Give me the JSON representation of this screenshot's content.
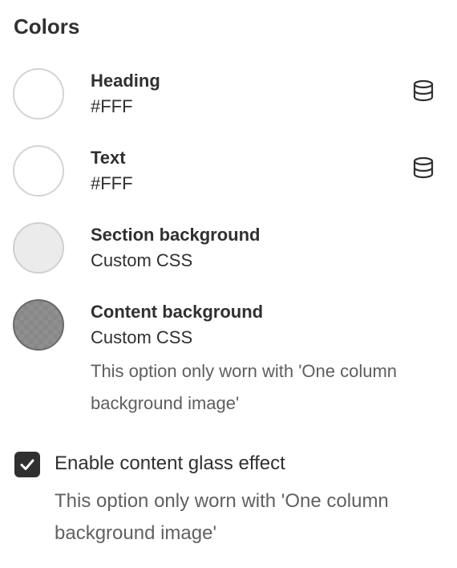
{
  "section": {
    "title": "Colors"
  },
  "colors": [
    {
      "label": "Heading",
      "value": "#FFF",
      "swatch_color": "#FFFFFF",
      "icon": "database-icon"
    },
    {
      "label": "Text",
      "value": "#FFF",
      "swatch_color": "#FFFFFF",
      "icon": "database-icon"
    },
    {
      "label": "Section background",
      "value": "Custom CSS",
      "swatch_color": "#EBEBEB"
    },
    {
      "label": "Content background",
      "value": "Custom CSS",
      "swatch_color": "#8F8F8F",
      "help": "This option only worn with 'One column background image'"
    }
  ],
  "glass_effect": {
    "label": "Enable content glass effect",
    "checked": true,
    "help": "This option only worn with 'One column background image'"
  }
}
